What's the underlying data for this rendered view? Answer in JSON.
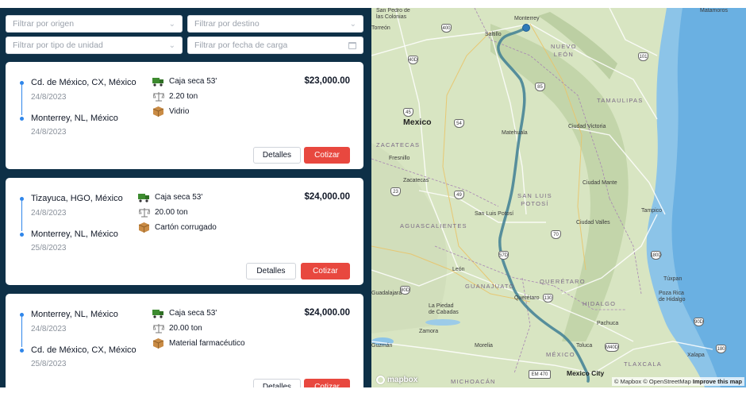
{
  "filters": {
    "origin": "Filtrar por origen",
    "destination": "Filtrar por destino",
    "unit_type": "Filtrar por tipo de unidad",
    "load_date": "Filtrar por fecha de carga"
  },
  "cards": [
    {
      "origin": "Cd. de México, CX, México",
      "origin_date": "24/8/2023",
      "destination": "Monterrey, NL, México",
      "destination_date": "24/8/2023",
      "unit": "Caja seca 53'",
      "weight": "2.20 ton",
      "product": "Vidrio",
      "price": "$23,000.00",
      "details_label": "Detalles",
      "quote_label": "Cotizar"
    },
    {
      "origin": "Tizayuca, HGO, México",
      "origin_date": "24/8/2023",
      "destination": "Monterrey, NL, México",
      "destination_date": "25/8/2023",
      "unit": "Caja seca 53'",
      "weight": "20.00 ton",
      "product": "Cartón corrugado",
      "price": "$24,000.00",
      "details_label": "Detalles",
      "quote_label": "Cotizar"
    },
    {
      "origin": "Monterrey, NL, México",
      "origin_date": "24/8/2023",
      "destination": "Cd. de México, CX, México",
      "destination_date": "25/8/2023",
      "unit": "Caja seca 53'",
      "weight": "20.00 ton",
      "product": "Material farmacéutico",
      "price": "$24,000.00",
      "details_label": "Detalles",
      "quote_label": "Cotizar"
    }
  ],
  "map": {
    "labels": {
      "country": "Mexico",
      "mexico_city": "Mexico City",
      "monterrey": "Monterrey",
      "saltillo": "Saltillo",
      "matamoros": "Matamoros",
      "san_pedro": "San Pedro de\nlas Colonias",
      "torreon": "Torreón",
      "nuevo_leon": "NUEVO\nLEÓN",
      "tamaulipas": "TAMAULIPAS",
      "zacatecas_state": "ZACATECAS",
      "zacatecas": "Zacatecas",
      "fresnillo": "Fresnillo",
      "matehuala": "Matehuala",
      "ciudad_victoria": "Ciudad Victoria",
      "ciudad_mante": "Ciudad Mante",
      "ciudad_valles": "Ciudad Valles",
      "tampico": "Tampico",
      "slp_state": "SAN LUIS\nPOTOSÍ",
      "slp": "San Luis Potosí",
      "aguascalientes": "AGUASCALIENTES",
      "leon": "León",
      "guanajuato": "GUANAJUATO",
      "queretaro_state": "QUERÉTARO",
      "queretaro": "Querétaro",
      "hidalgo": "HIDALGO",
      "pachuca": "Pachuca",
      "tuxpan": "Túxpan",
      "poza_rica": "Poza Rica\nde Hidalgo",
      "guadalajara": "Guadalajara",
      "la_piedad": "La Piedad\nde Cabadas",
      "zamora": "Zamora",
      "morelia": "Morelia",
      "guzman": "Guzmán",
      "toluca": "Toluca",
      "tlaxcala": "TLAXCALA",
      "xalapa": "Xalapa",
      "mexico_state": "MÉXICO",
      "michoacan": "MICHOACÁN"
    },
    "shields": [
      "400",
      "40D",
      "101",
      "54",
      "85",
      "45",
      "49",
      "23",
      "70",
      "57D",
      "80D",
      "130",
      "180D",
      "90D",
      "M40D",
      "EM 470",
      "180"
    ],
    "attribution_prefix": "© Mapbox © OpenStreetMap",
    "attribution_link": "Improve this map",
    "logo": "mapbox"
  }
}
